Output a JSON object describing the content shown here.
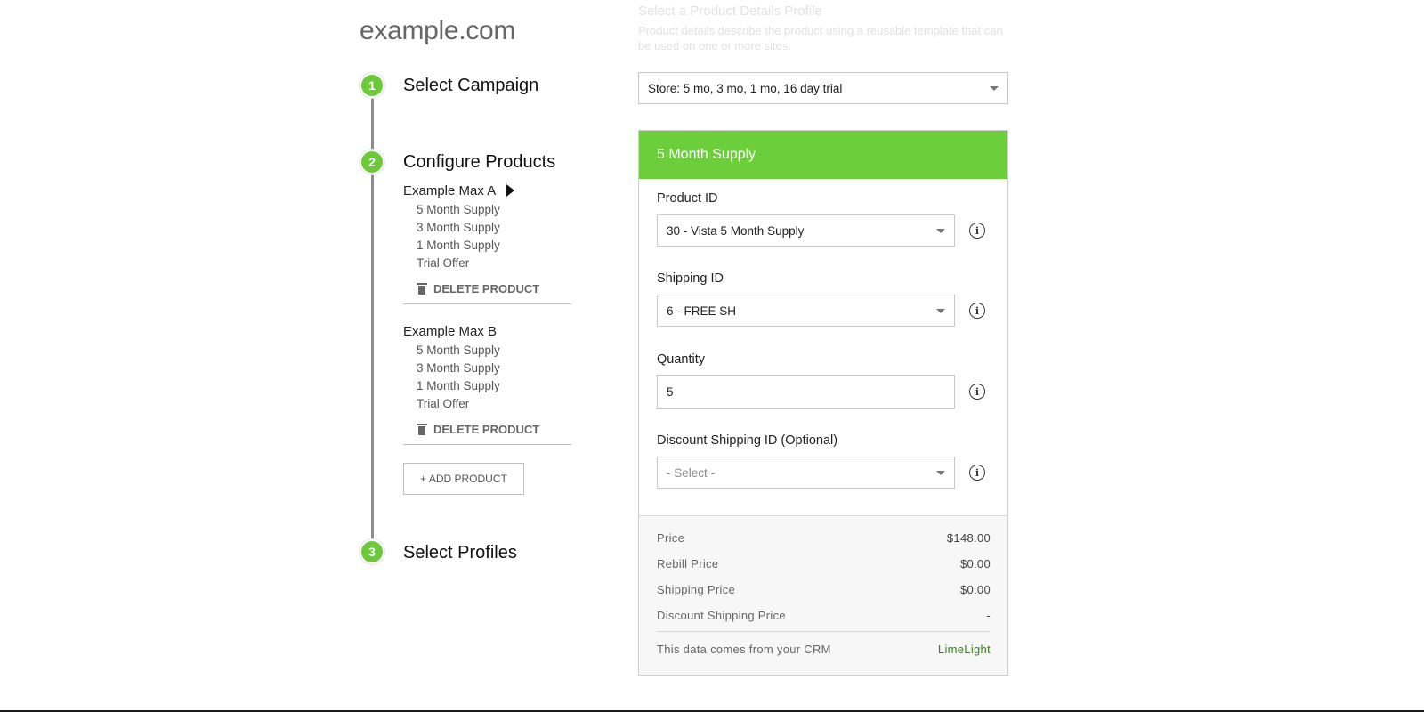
{
  "site": {
    "title": "example.com"
  },
  "steps": [
    {
      "number": "1",
      "title": "Select Campaign"
    },
    {
      "number": "2",
      "title": "Configure Products"
    },
    {
      "number": "3",
      "title": "Select Profiles"
    }
  ],
  "products": [
    {
      "name": "Example Max A",
      "offers": [
        "5 Month Supply",
        "3 Month Supply",
        "1 Month Supply",
        "Trial Offer"
      ],
      "delete_label": "DELETE PRODUCT"
    },
    {
      "name": "Example Max B",
      "offers": [
        "5 Month Supply",
        "3 Month Supply",
        "1 Month Supply",
        "Trial Offer"
      ],
      "delete_label": "DELETE PRODUCT"
    }
  ],
  "add_product_label": "+ ADD PRODUCT",
  "profile_header": {
    "title": "Select a Product Details Profile",
    "description": "Product details describe the product using a reusable template that can be used on one or more sites."
  },
  "campaign_select": {
    "value": "Store: 5 mo, 3 mo, 1 mo, 16 day trial"
  },
  "card": {
    "header": "5 Month Supply",
    "product_id": {
      "label": "Product ID",
      "value": "30 - Vista 5 Month Supply"
    },
    "shipping_id": {
      "label": "Shipping ID",
      "value": "6 - FREE SH"
    },
    "quantity": {
      "label": "Quantity",
      "value": "5"
    },
    "discount_shipping": {
      "label": "Discount Shipping ID (Optional)",
      "placeholder": "- Select -"
    },
    "prices": [
      {
        "label": "Price",
        "value": "$148.00"
      },
      {
        "label": "Rebill Price",
        "value": "$0.00"
      },
      {
        "label": "Shipping Price",
        "value": "$0.00"
      },
      {
        "label": "Discount Shipping Price",
        "value": "-"
      }
    ],
    "crm_note": "This data comes from your CRM",
    "crm_name": "LimeLight"
  },
  "colors": {
    "accent": "#6cce3a",
    "crm_link": "#2e8b0e"
  },
  "icons": {
    "info": "info-icon",
    "trash": "trash-icon",
    "caret": "caret-right-icon"
  }
}
